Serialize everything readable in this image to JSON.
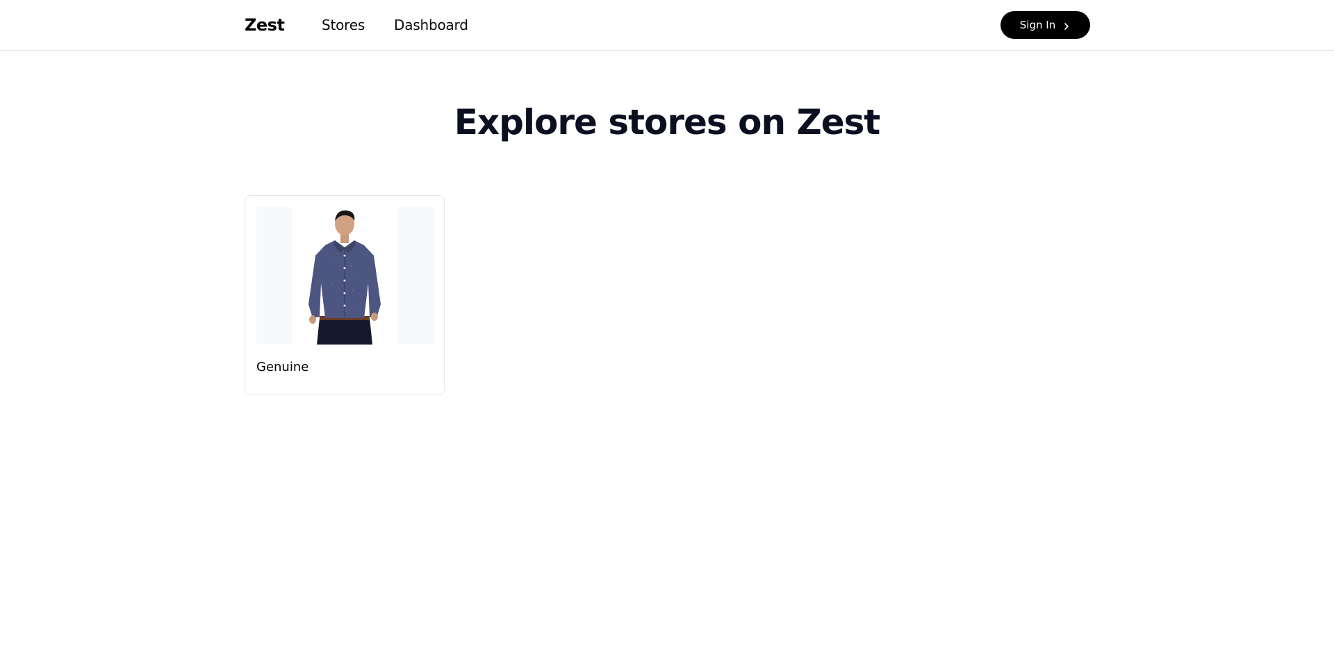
{
  "header": {
    "logo": "Zest",
    "nav": [
      {
        "label": "Stores"
      },
      {
        "label": "Dashboard"
      }
    ],
    "signin_label": "Sign In",
    "signin_icon": "chevron-right-icon"
  },
  "main": {
    "title": "Explore stores on Zest",
    "stores": [
      {
        "name": "Genuine",
        "image": "store-image"
      }
    ]
  },
  "colors": {
    "accent": "#000000",
    "title": "#0b1020",
    "border": "#e5e7eb",
    "image_bg": "#f8f9fb"
  }
}
